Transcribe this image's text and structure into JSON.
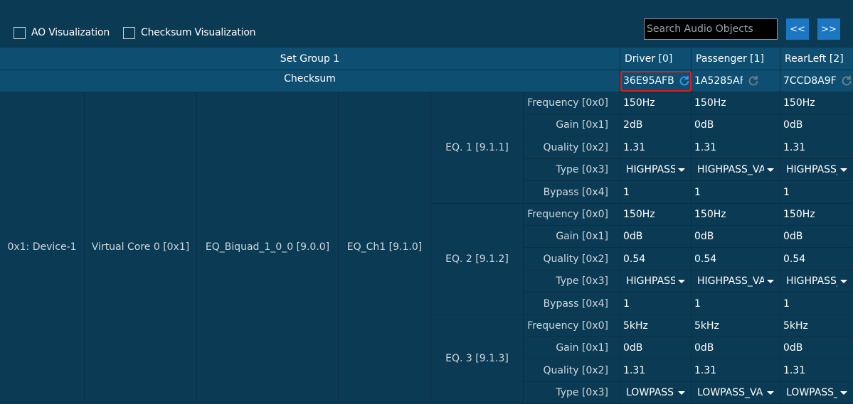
{
  "toolbar": {
    "ao_visualization": "AO Visualization",
    "checksum_visualization": "Checksum Visualization",
    "search_placeholder": "Search Audio Objects",
    "prev_label": "<<",
    "next_label": ">>"
  },
  "header": {
    "set_group": "Set Group 1",
    "checksum_label": "Checksum",
    "columns": [
      "Driver [0]",
      "Passenger [1]",
      "RearLeft [2]"
    ],
    "checksums": [
      "36E95AFB",
      "1A5285AF",
      "7CCD8A9F"
    ]
  },
  "tree": {
    "device": "0x1: Device-1",
    "core": "Virtual Core 0 [0x1]",
    "object": "EQ_Biquad_1_0_0 [9.0.0]",
    "channel": "EQ_Ch1 [9.1.0]"
  },
  "eq_blocks": [
    {
      "label": "EQ. 1 [9.1.1]",
      "params": [
        {
          "name": "Frequency [0x0]",
          "values": [
            "150Hz",
            "150Hz",
            "150Hz"
          ]
        },
        {
          "name": "Gain [0x1]",
          "values": [
            "2dB",
            "0dB",
            "0dB"
          ]
        },
        {
          "name": "Quality [0x2]",
          "values": [
            "1.31",
            "1.31",
            "1.31"
          ]
        },
        {
          "name": "Type [0x3]",
          "values": [
            "HIGHPASS",
            "HIGHPASS_VA",
            "HIGHPASS_"
          ],
          "dropdown": true
        },
        {
          "name": "Bypass [0x4]",
          "values": [
            "1",
            "1",
            "1"
          ]
        }
      ]
    },
    {
      "label": "EQ. 2 [9.1.2]",
      "params": [
        {
          "name": "Frequency [0x0]",
          "values": [
            "150Hz",
            "150Hz",
            "150Hz"
          ]
        },
        {
          "name": "Gain [0x1]",
          "values": [
            "0dB",
            "0dB",
            "0dB"
          ]
        },
        {
          "name": "Quality [0x2]",
          "values": [
            "0.54",
            "0.54",
            "0.54"
          ]
        },
        {
          "name": "Type [0x3]",
          "values": [
            "HIGHPASS",
            "HIGHPASS_VA",
            "HIGHPASS_"
          ],
          "dropdown": true
        },
        {
          "name": "Bypass [0x4]",
          "values": [
            "1",
            "1",
            "1"
          ]
        }
      ]
    },
    {
      "label": "EQ. 3 [9.1.3]",
      "params": [
        {
          "name": "Frequency [0x0]",
          "values": [
            "5kHz",
            "5kHz",
            "5kHz"
          ]
        },
        {
          "name": "Gain [0x1]",
          "values": [
            "0dB",
            "0dB",
            "0dB"
          ]
        },
        {
          "name": "Quality [0x2]",
          "values": [
            "1.31",
            "1.31",
            "1.31"
          ]
        },
        {
          "name": "Type [0x3]",
          "values": [
            "LOWPASS",
            "LOWPASS_VA",
            "LOWPASS_\\"
          ],
          "dropdown": true
        }
      ]
    }
  ],
  "colors": {
    "background": "#0b3a54",
    "header": "#0d4e71",
    "accent": "#1b77c4",
    "highlight": "#e01b1b",
    "refresh_active": "#2f9be8",
    "refresh_inactive": "#6b7d88"
  }
}
